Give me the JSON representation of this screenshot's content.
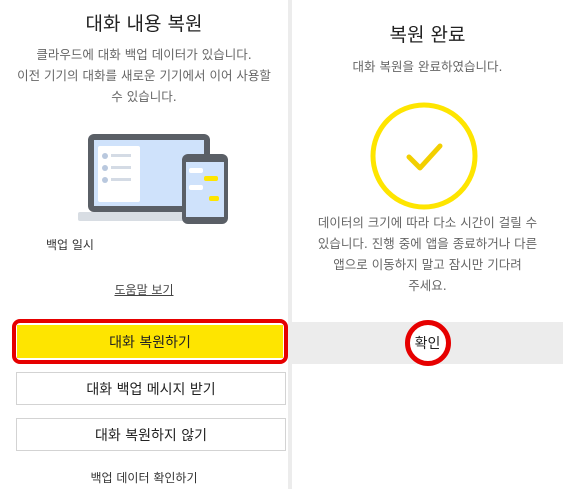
{
  "left": {
    "title": "대화 내용 복원",
    "desc_lines": [
      "클라우드에 대화 백업 데이터가 있습니다.",
      "이전 기기의 대화를 새로운 기기에서 이어 사용할",
      "수 있습니다."
    ],
    "backup_date_label": "백업 일시",
    "help_link": "도움말 보기",
    "restore_button": "대화 복원하기",
    "receive_messages_button": "대화 백업 메시지 받기",
    "skip_button": "대화 복원하지 않기",
    "check_data_link": "백업 데이터 확인하기"
  },
  "right": {
    "title": "복원 완료",
    "subtitle": "대화 복원을 완료하였습니다.",
    "notice_lines": [
      "데이터의 크기에 따라 다소 시간이 걸릴 수",
      "있습니다. 진행 중에 앱을 종료하거나 다른",
      "앱으로 이동하지 말고 잠시만 기다려",
      "주세요."
    ],
    "confirm_button": "확인"
  },
  "colors": {
    "accent_yellow": "#fee500",
    "highlight_red": "#e60000"
  }
}
